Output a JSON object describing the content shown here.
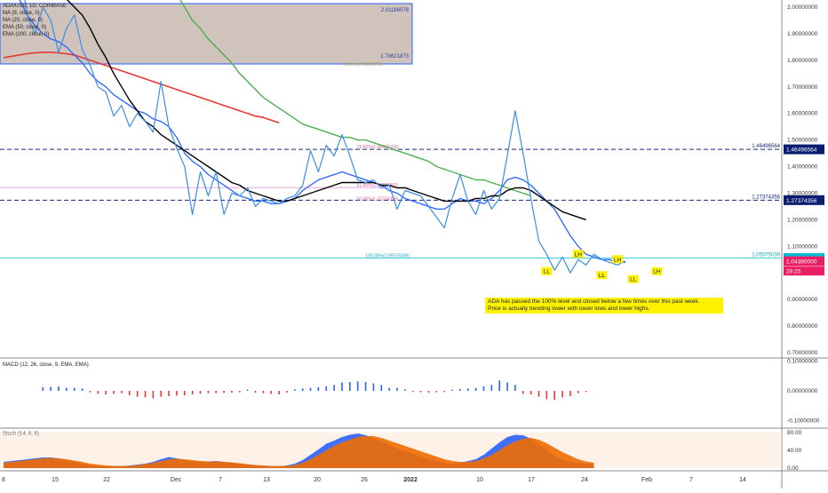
{
  "header": {
    "symbol": "ADA/USD, 1D, COINBASE",
    "indicators": [
      "MA (9, close, 0)",
      "MA (20, close, 0)",
      "EMA (50, close, 0)",
      "EMA (200, close, 0)"
    ]
  },
  "annotation": [
    "ADA has passed the 100% level and closed below a few times over this past week.",
    "Price is actually trending lower with lower lows and lower highs."
  ],
  "colors": {
    "price": "#3a8ee6",
    "ma20": "#2962ff",
    "ema50": "#4caf50",
    "ema200": "#e53935",
    "ma9": "#000000",
    "level_line": "#1a237e",
    "fib_100": "#26c6da",
    "tag_price": "#0b1d6e",
    "tag_current": "#e91e63",
    "tag_cyan": "#00bcd4",
    "ll_lh": "#fff200",
    "macd_up": "#2962ff",
    "macd_down": "#e53935",
    "stoch_k": "#2962ff",
    "stoch_d": "#ef6c00",
    "box_fill": "#c8b8b0",
    "box_border": "#2962ff"
  },
  "chart_data": [
    {
      "type": "line",
      "name": "price",
      "x_labels": [
        "8",
        "15",
        "22",
        "Dec",
        "7",
        "13",
        "20",
        "26",
        "2022",
        "10",
        "17",
        "24",
        "Feb",
        "7",
        "14"
      ],
      "y_ticks": [
        "2.00000000",
        "1.90000000",
        "1.80000000",
        "1.70000000",
        "1.60000000",
        "1.50000000",
        "1.40000000",
        "1.30000000",
        "1.20000000",
        "1.10000000",
        "1.00000000",
        "0.90000000",
        "0.80000000",
        "0.70000000"
      ],
      "ylim": [
        0.695,
        2.03
      ],
      "price_series": [
        2.27,
        2.22,
        2.16,
        1.97,
        1.9,
        2.0,
        1.95,
        1.83,
        1.92,
        1.97,
        1.84,
        1.78,
        1.7,
        1.68,
        1.59,
        1.63,
        1.55,
        1.6,
        1.57,
        1.53,
        1.72,
        1.55,
        1.47,
        1.4,
        1.22,
        1.38,
        1.29,
        1.38,
        1.22,
        1.3,
        1.29,
        1.32,
        1.25,
        1.28,
        1.27,
        1.26,
        1.28,
        1.29,
        1.33,
        1.46,
        1.38,
        1.48,
        1.44,
        1.52,
        1.44,
        1.35,
        1.34,
        1.35,
        1.32,
        1.33,
        1.24,
        1.31,
        1.3,
        1.29,
        1.25,
        1.21,
        1.17,
        1.28,
        1.37,
        1.27,
        1.22,
        1.31,
        1.24,
        1.28,
        1.44,
        1.61,
        1.45,
        1.28,
        1.12,
        1.07,
        1.01,
        1.06,
        1.0,
        1.05,
        1.03,
        1.07,
        1.05,
        1.04,
        1.03,
        1.045
      ],
      "ma9": [
        2.15,
        2.13,
        2.12,
        2.1,
        2.09,
        2.08,
        2.07,
        2.05,
        2.03,
        2.0,
        1.97,
        1.92,
        1.86,
        1.81,
        1.75,
        1.7,
        1.65,
        1.61,
        1.57,
        1.55,
        1.52,
        1.5,
        1.48,
        1.46,
        1.44,
        1.42,
        1.4,
        1.38,
        1.36,
        1.34,
        1.33,
        1.31,
        1.3,
        1.29,
        1.28,
        1.27,
        1.27,
        1.28,
        1.29,
        1.3,
        1.31,
        1.32,
        1.33,
        1.34,
        1.34,
        1.34,
        1.34,
        1.34,
        1.33,
        1.33,
        1.32,
        1.32,
        1.31,
        1.3,
        1.29,
        1.28,
        1.27,
        1.27,
        1.27,
        1.27,
        1.28,
        1.28,
        1.29,
        1.29,
        1.31,
        1.32,
        1.32,
        1.31,
        1.29,
        1.27,
        1.25,
        1.23,
        1.22,
        1.21,
        1.2
      ],
      "ma20": [
        2.18,
        2.1,
        2.03,
        1.97,
        1.93,
        1.9,
        1.88,
        1.87,
        1.85,
        1.82,
        1.79,
        1.75,
        1.72,
        1.7,
        1.67,
        1.65,
        1.63,
        1.61,
        1.6,
        1.58,
        1.57,
        1.55,
        1.51,
        1.45,
        1.42,
        1.4,
        1.37,
        1.35,
        1.33,
        1.31,
        1.29,
        1.28,
        1.27,
        1.27,
        1.26,
        1.26,
        1.27,
        1.28,
        1.31,
        1.33,
        1.35,
        1.36,
        1.37,
        1.38,
        1.37,
        1.36,
        1.35,
        1.34,
        1.33,
        1.31,
        1.3,
        1.28,
        1.27,
        1.26,
        1.25,
        1.24,
        1.24,
        1.26,
        1.28,
        1.27,
        1.27,
        1.26,
        1.28,
        1.31,
        1.35,
        1.36,
        1.35,
        1.33,
        1.3,
        1.27,
        1.24,
        1.19,
        1.14,
        1.1,
        1.07,
        1.06,
        1.05,
        1.05,
        1.04,
        1.04
      ],
      "ema50": [
        2.2,
        2.12,
        2.05,
        2.0,
        1.95,
        1.92,
        1.88,
        1.85,
        1.82,
        1.79,
        1.75,
        1.72,
        1.69,
        1.66,
        1.64,
        1.62,
        1.6,
        1.58,
        1.56,
        1.55,
        1.54,
        1.53,
        1.52,
        1.51,
        1.51,
        1.5,
        1.5,
        1.49,
        1.48,
        1.47,
        1.46,
        1.45,
        1.44,
        1.43,
        1.42,
        1.4,
        1.39,
        1.38,
        1.37,
        1.36,
        1.35,
        1.35,
        1.34,
        1.33,
        1.32,
        1.31,
        1.3,
        1.29
      ],
      "ema200": [
        1.81,
        1.815,
        1.82,
        1.825,
        1.828,
        1.83,
        1.83,
        1.828,
        1.825,
        1.82,
        1.81,
        1.8,
        1.79,
        1.78,
        1.77,
        1.76,
        1.75,
        1.74,
        1.73,
        1.72,
        1.71,
        1.7,
        1.69,
        1.68,
        1.67,
        1.66,
        1.65,
        1.64,
        1.63,
        1.62,
        1.61,
        1.6,
        1.59,
        1.585,
        1.575,
        1.565
      ],
      "levels": [
        {
          "y": 1.46496564,
          "label": "1.46496564"
        },
        {
          "y": 1.27374356,
          "label": "1.27374356"
        }
      ],
      "fib_100": {
        "y": 1.05575039,
        "label": "100.00%(1.05575039)",
        "right_label": "1.05575039"
      },
      "fib_texts": [
        "78.60%(1.46496564)",
        "61.80%(1.32126882)",
        "50.00%(1.27374356)"
      ],
      "range_box": {
        "top_value": "2.01186078",
        "bottom_value": "1.78621873",
        "bottom_label": "0.00%(1.78621873)"
      },
      "marks": [
        {
          "text": "LL",
          "x": 69,
          "y": 1.005
        },
        {
          "text": "LH",
          "x": 73,
          "y": 1.07
        },
        {
          "text": "LH",
          "x": 78,
          "y": 1.05
        },
        {
          "text": "LL",
          "x": 76,
          "y": 0.99
        },
        {
          "text": "LL",
          "x": 80,
          "y": 0.975
        },
        {
          "text": "LH",
          "x": 83,
          "y": 1.005
        }
      ],
      "price_tags": [
        {
          "text": "1.46496564",
          "y": 1.46496564,
          "color": "#0b1d6e"
        },
        {
          "text": "1.27374356",
          "y": 1.27374356,
          "color": "#0b1d6e"
        },
        {
          "text": "1.05575039",
          "y": 1.05575039,
          "color": "#00bcd4"
        },
        {
          "text": "1.04380000",
          "y": 1.0438,
          "color": "#e91e63"
        }
      ],
      "countdown": "28:25"
    },
    {
      "type": "bar",
      "name": "MACD (12, 26, close, 9, EMA, EMA)",
      "y_ticks": [
        "0.10000000",
        "0.00000000",
        "-0.10000000"
      ],
      "ylim": [
        -0.11,
        0.11
      ],
      "values": [
        0.012,
        0.013,
        0.015,
        0.01,
        0.01,
        0.008,
        -0.005,
        -0.01,
        -0.012,
        -0.01,
        -0.008,
        -0.015,
        -0.02,
        -0.022,
        -0.025,
        -0.02,
        -0.018,
        -0.016,
        -0.015,
        -0.012,
        -0.01,
        -0.008,
        -0.008,
        -0.007,
        -0.006,
        -0.005,
        0.004,
        -0.006,
        -0.008,
        -0.01,
        -0.012,
        -0.006,
        0.005,
        0.008,
        0.01,
        0.012,
        0.015,
        0.02,
        0.028,
        0.03,
        0.032,
        0.03,
        0.025,
        0.02,
        0.01,
        0.01,
        0.005,
        -0.004,
        -0.005,
        -0.006,
        -0.005,
        -0.004,
        0.004,
        0.006,
        0.008,
        0.01,
        0.015,
        0.02,
        0.035,
        0.028,
        0.02,
        -0.01,
        -0.012,
        -0.02,
        -0.028,
        -0.03,
        -0.022,
        -0.018,
        -0.008,
        -0.004
      ],
      "label": "MACD (12, 26, close, 9, EMA, EMA)"
    },
    {
      "type": "area",
      "name": "Stoch (14, 6, 6)",
      "y_ticks": [
        "80.00",
        "40.00",
        "0.00"
      ],
      "ylim": [
        -15,
        88
      ],
      "k": [
        14,
        16,
        18,
        20,
        22,
        24,
        24,
        22,
        18,
        14,
        10,
        6,
        5,
        4,
        4,
        4,
        6,
        8,
        10,
        14,
        20,
        25,
        22,
        18,
        16,
        15,
        15,
        16,
        14,
        12,
        10,
        8,
        6,
        5,
        4,
        4,
        6,
        10,
        18,
        30,
        42,
        55,
        62,
        70,
        75,
        78,
        74,
        68,
        60,
        52,
        44,
        38,
        32,
        26,
        20,
        16,
        12,
        10,
        12,
        16,
        20,
        30,
        44,
        58,
        70,
        75,
        74,
        66,
        54,
        40,
        28,
        20,
        15,
        12,
        10,
        8
      ],
      "d": [
        12,
        14,
        16,
        18,
        20,
        22,
        23,
        22,
        20,
        17,
        14,
        10,
        8,
        6,
        5,
        5,
        5,
        7,
        9,
        12,
        16,
        20,
        21,
        20,
        18,
        16,
        15,
        15,
        14,
        13,
        11,
        9,
        7,
        6,
        5,
        5,
        5,
        7,
        12,
        20,
        30,
        40,
        50,
        58,
        64,
        70,
        72,
        72,
        68,
        62,
        56,
        50,
        44,
        38,
        32,
        26,
        20,
        16,
        14,
        14,
        16,
        22,
        30,
        40,
        52,
        60,
        66,
        68,
        64,
        56,
        46,
        36,
        28,
        20,
        15,
        12
      ],
      "label": "Stoch (14, 6, 6)"
    }
  ]
}
